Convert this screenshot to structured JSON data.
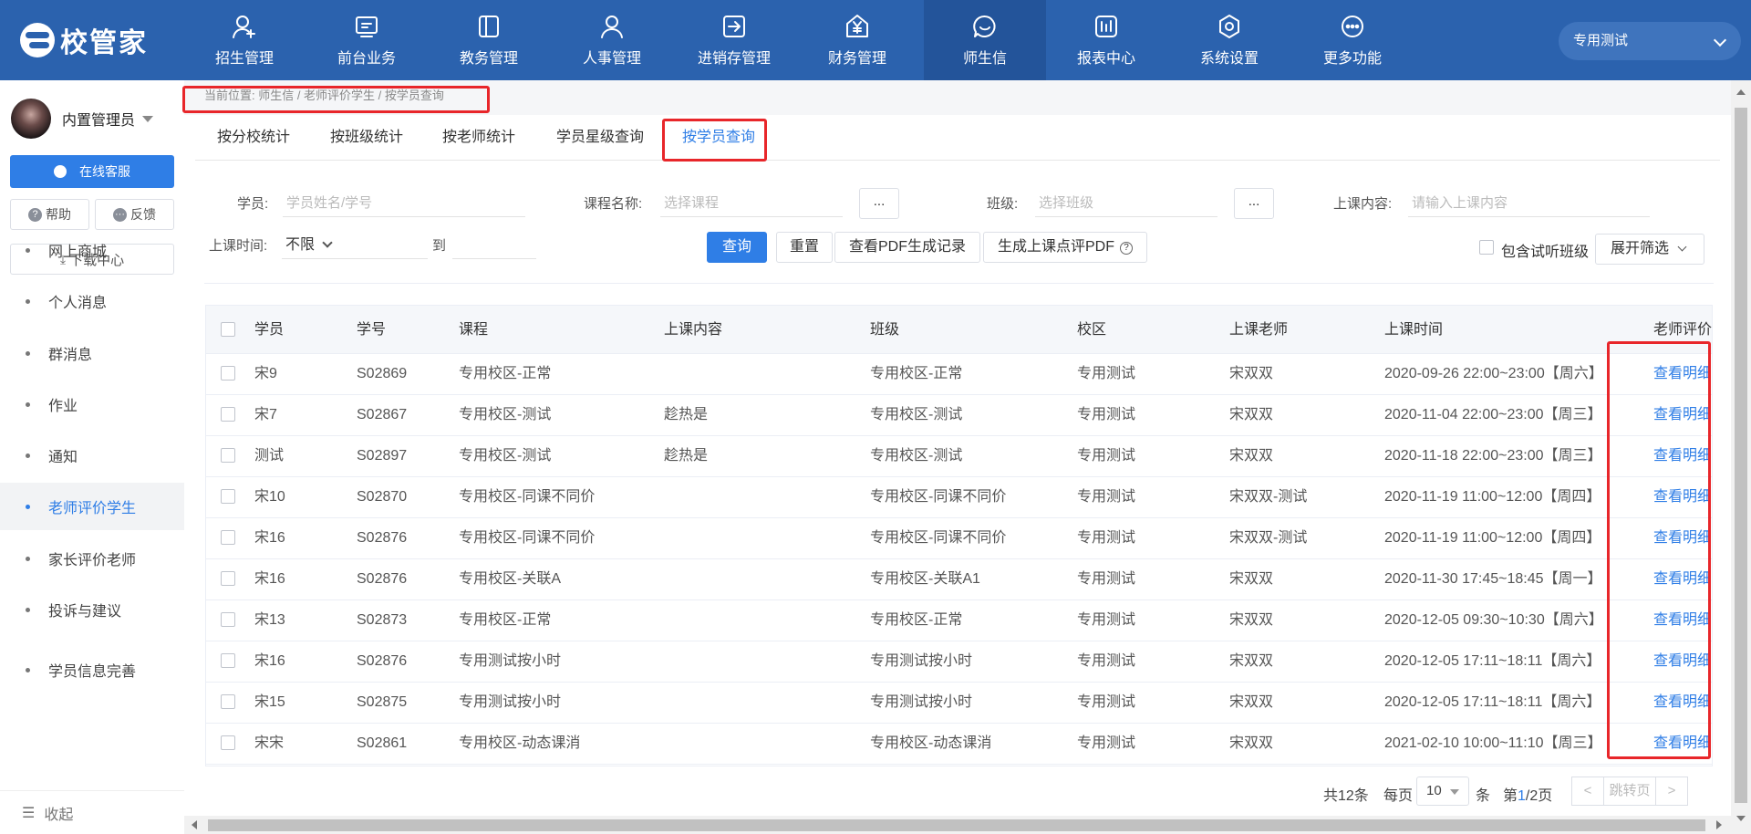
{
  "app": {
    "logo_text": "校管家"
  },
  "nav": [
    {
      "label": "招生管理",
      "icon": "add-user-icon"
    },
    {
      "label": "前台业务",
      "icon": "monitor-icon"
    },
    {
      "label": "教务管理",
      "icon": "book-icon"
    },
    {
      "label": "人事管理",
      "icon": "person-icon"
    },
    {
      "label": "进销存管理",
      "icon": "login-box-icon"
    },
    {
      "label": "财务管理",
      "icon": "yen-house-icon"
    },
    {
      "label": "师生信",
      "icon": "message-circle-icon",
      "active": true
    },
    {
      "label": "报表中心",
      "icon": "chart-bars-icon"
    },
    {
      "label": "系统设置",
      "icon": "settings-hex-icon"
    },
    {
      "label": "更多功能",
      "icon": "more-dots-icon"
    }
  ],
  "tenant": {
    "label": "专用测试"
  },
  "sidebar": {
    "user_name": "内置管理员",
    "online_service": "在线客服",
    "help": "帮助",
    "feedback": "反馈",
    "download_center": "下载中心",
    "items": [
      {
        "label": "网上商城"
      },
      {
        "label": "个人消息"
      },
      {
        "label": "群消息"
      },
      {
        "label": "作业"
      },
      {
        "label": "通知"
      },
      {
        "label": "老师评价学生",
        "active": true
      },
      {
        "label": "家长评价老师"
      },
      {
        "label": "投诉与建议"
      },
      {
        "label": "学员信息完善"
      }
    ],
    "collapse": "收起"
  },
  "breadcrumb": "当前位置:  师生信 / 老师评价学生 / 按学员查询",
  "tabs": [
    {
      "label": "按分校统计"
    },
    {
      "label": "按班级统计"
    },
    {
      "label": "按老师统计"
    },
    {
      "label": "学员星级查询"
    },
    {
      "label": "按学员查询",
      "active": true
    }
  ],
  "filters": {
    "student_label": "学员:",
    "student_placeholder": "学员姓名/学号",
    "course_label": "课程名称:",
    "course_placeholder": "选择课程",
    "dots": "...",
    "class_label": "班级:",
    "class_placeholder": "选择班级",
    "content_label": "上课内容:",
    "content_placeholder": "请输入上课内容",
    "time_label": "上课时间:",
    "time_value": "不限",
    "to": "到",
    "include_trial": "包含试听班级",
    "expand": "展开筛选"
  },
  "actions": {
    "query": "查询",
    "reset": "重置",
    "pdf_log": "查看PDF生成记录",
    "gen_pdf": "生成上课点评PDF"
  },
  "table": {
    "columns": [
      "学员",
      "学号",
      "课程",
      "上课内容",
      "班级",
      "校区",
      "上课老师",
      "上课时间",
      "老师评价"
    ],
    "rows": [
      [
        "宋9",
        "S02869",
        "专用校区-正常",
        "",
        "专用校区-正常",
        "专用测试",
        "宋双双",
        "2020-09-26 22:00~23:00【周六】",
        "查看明细"
      ],
      [
        "宋7",
        "S02867",
        "专用校区-测试",
        "趁热是",
        "专用校区-测试",
        "专用测试",
        "宋双双",
        "2020-11-04 22:00~23:00【周三】",
        "查看明细"
      ],
      [
        "测试",
        "S02897",
        "专用校区-测试",
        "趁热是",
        "专用校区-测试",
        "专用测试",
        "宋双双",
        "2020-11-18 22:00~23:00【周三】",
        "查看明细"
      ],
      [
        "宋10",
        "S02870",
        "专用校区-同课不同价",
        "",
        "专用校区-同课不同价",
        "专用测试",
        "宋双双-测试",
        "2020-11-19 11:00~12:00【周四】",
        "查看明细"
      ],
      [
        "宋16",
        "S02876",
        "专用校区-同课不同价",
        "",
        "专用校区-同课不同价",
        "专用测试",
        "宋双双-测试",
        "2020-11-19 11:00~12:00【周四】",
        "查看明细"
      ],
      [
        "宋16",
        "S02876",
        "专用校区-关联A",
        "",
        "专用校区-关联A1",
        "专用测试",
        "宋双双",
        "2020-11-30 17:45~18:45【周一】",
        "查看明细"
      ],
      [
        "宋13",
        "S02873",
        "专用校区-正常",
        "",
        "专用校区-正常",
        "专用测试",
        "宋双双",
        "2020-12-05 09:30~10:30【周六】",
        "查看明细"
      ],
      [
        "宋16",
        "S02876",
        "专用测试按小时",
        "",
        "专用测试按小时",
        "专用测试",
        "宋双双",
        "2020-12-05 17:11~18:11【周六】",
        "查看明细"
      ],
      [
        "宋15",
        "S02875",
        "专用测试按小时",
        "",
        "专用测试按小时",
        "专用测试",
        "宋双双",
        "2020-12-05 17:11~18:11【周六】",
        "查看明细"
      ],
      [
        "宋宋",
        "S02861",
        "专用校区-动态课消",
        "",
        "专用校区-动态课消",
        "专用测试",
        "宋双双",
        "2021-02-10 10:00~11:10【周三】",
        "查看明细"
      ]
    ]
  },
  "pagination": {
    "total": "共12条",
    "per_page_label": "每页",
    "per_page": "10",
    "unit": "条",
    "page_prefix": "第",
    "current_page": "1",
    "page_suffix": "/2页",
    "jump": "跳转页"
  },
  "colors": {
    "topbar": "#2b62ae",
    "accent": "#2f7ee6",
    "highlight_box": "#e8262a"
  }
}
